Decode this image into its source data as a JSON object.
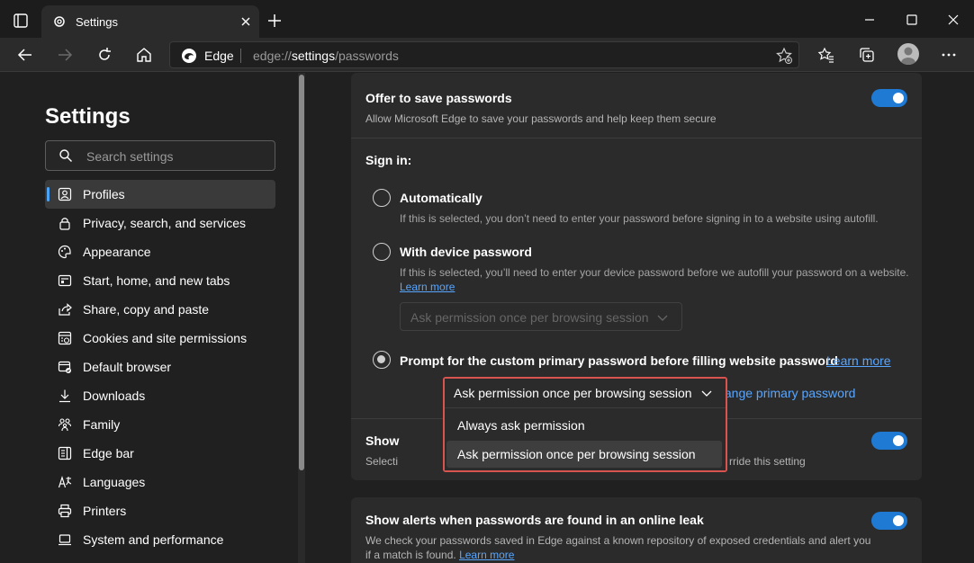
{
  "window": {
    "tab_title": "Settings"
  },
  "toolbar": {
    "edge_label": "Edge",
    "url_prefix": "edge://",
    "url_main": "settings",
    "url_suffix": "/passwords"
  },
  "sidebar": {
    "title": "Settings",
    "search_placeholder": "Search settings",
    "items": [
      {
        "label": "Profiles",
        "icon": "profile-icon"
      },
      {
        "label": "Privacy, search, and services",
        "icon": "lock-icon"
      },
      {
        "label": "Appearance",
        "icon": "palette-icon"
      },
      {
        "label": "Start, home, and new tabs",
        "icon": "home-tabs-icon"
      },
      {
        "label": "Share, copy and paste",
        "icon": "share-icon"
      },
      {
        "label": "Cookies and site permissions",
        "icon": "cookies-icon"
      },
      {
        "label": "Default browser",
        "icon": "browser-icon"
      },
      {
        "label": "Downloads",
        "icon": "download-icon"
      },
      {
        "label": "Family",
        "icon": "family-icon"
      },
      {
        "label": "Edge bar",
        "icon": "edge-bar-icon"
      },
      {
        "label": "Languages",
        "icon": "languages-icon"
      },
      {
        "label": "Printers",
        "icon": "printer-icon"
      },
      {
        "label": "System and performance",
        "icon": "system-icon"
      }
    ]
  },
  "main": {
    "offer": {
      "title": "Offer to save passwords",
      "subtitle": "Allow Microsoft Edge to save your passwords and help keep them secure"
    },
    "signin": {
      "label": "Sign in:",
      "automatically": {
        "title": "Automatically",
        "subtitle": "If this is selected, you don’t need to enter your password before signing in to a website using autofill."
      },
      "device": {
        "title": "With device password",
        "subtitle": "If this is selected, you’ll need to enter your device password before we autofill your password on a website.",
        "learn_more": "Learn more",
        "select_value": "Ask permission once per browsing session"
      },
      "custom": {
        "title": "Prompt for the custom primary password before filling website password",
        "learn_more": "Learn more",
        "select_value": "Ask permission once per browsing session",
        "change_link": "Change primary password",
        "options": [
          "Always ask permission",
          "Ask permission once per browsing session"
        ]
      }
    },
    "show_row": {
      "title_partial": "Show",
      "sub_partial": "Selecti",
      "sub_right": "rride this setting"
    },
    "alerts": {
      "title": "Show alerts when passwords are found in an online leak",
      "subtitle": "We check your passwords saved in Edge against a known repository of exposed credentials and alert you",
      "subtitle2": "if a match is found.",
      "learn_more": "Learn more"
    }
  },
  "colors": {
    "accent": "#1f7ad4",
    "link": "#58a6ff",
    "highlight_box": "#d9534f"
  }
}
